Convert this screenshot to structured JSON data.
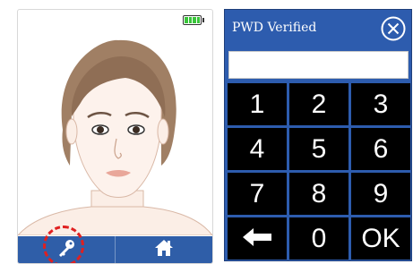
{
  "device": {
    "battery_icon": "battery-full-icon",
    "battery_color": "#39c43a",
    "bar_color": "#2f5ea8",
    "left_button_icon": "key-icon",
    "right_button_icon": "home-icon",
    "highlight_color": "#e02020"
  },
  "keypad": {
    "title": "PWD Verified",
    "close_icon": "close-icon",
    "password_value": "",
    "panel_color": "#2d5cae",
    "keys": [
      "1",
      "2",
      "3",
      "4",
      "5",
      "6",
      "7",
      "8",
      "9",
      "",
      "0",
      "OK"
    ],
    "back_icon": "arrow-left-icon"
  }
}
